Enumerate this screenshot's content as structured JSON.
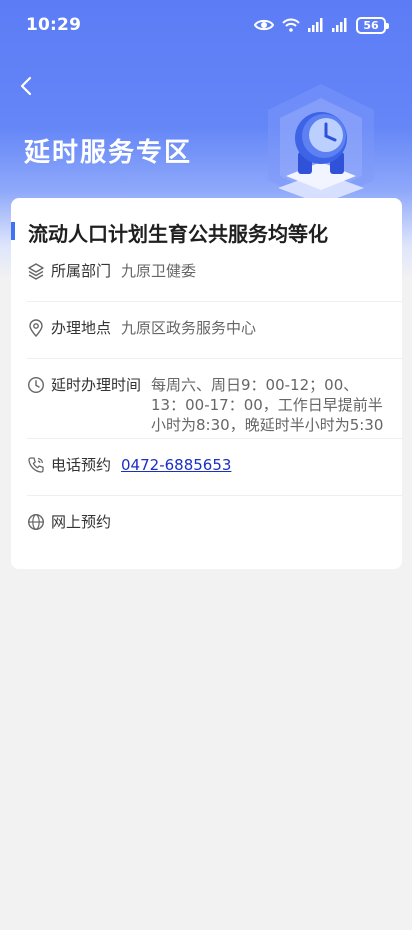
{
  "status_bar": {
    "time": "10:29",
    "battery": "56"
  },
  "header": {
    "title": "延时服务专区",
    "back_icon": "chevron-left-icon"
  },
  "card": {
    "title": "流动人口计划生育公共服务均等化",
    "rows": [
      {
        "icon": "layers-icon",
        "label": "所属部门",
        "value": "九原卫健委"
      },
      {
        "icon": "location-pin-icon",
        "label": "办理地点",
        "value": "九原区政务服务中心"
      },
      {
        "icon": "clock-icon",
        "label": "延时办理时间",
        "value": "每周六、周日9：00-12；00、13：00-17：00，工作日早提前半小时为8:30，晚延时半小时为5:30"
      },
      {
        "icon": "phone-icon",
        "label": "电话预约",
        "value": "0472-6885653"
      },
      {
        "icon": "globe-icon",
        "label": "网上预约",
        "value": ""
      }
    ]
  },
  "colors": {
    "banner": "#5c7cf6",
    "accent": "#3f72f5",
    "link": "#1a2fc4",
    "background": "#f2f2f2"
  }
}
